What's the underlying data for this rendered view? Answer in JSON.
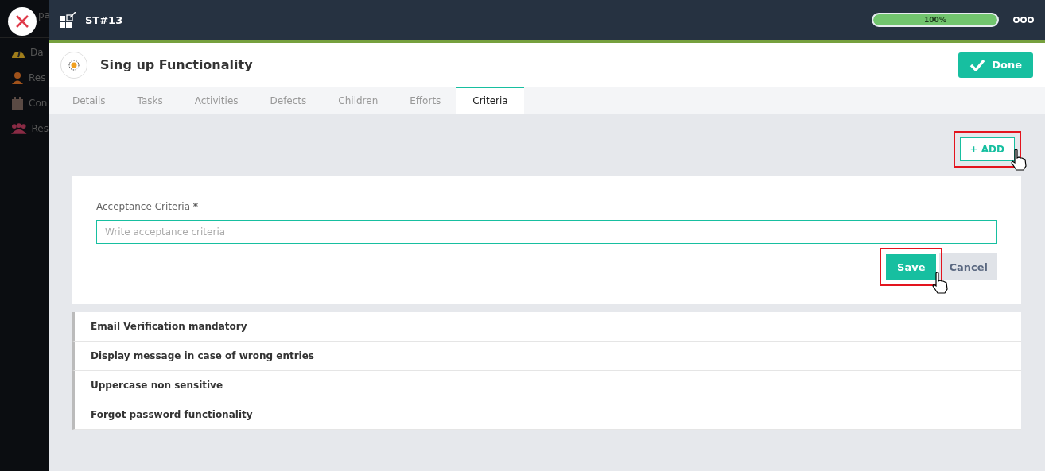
{
  "sidebar": {
    "header": "pa",
    "items": [
      {
        "label": "Da",
        "kind": "gauge"
      },
      {
        "label": "Res",
        "kind": "person"
      },
      {
        "label": "Con",
        "kind": "calendar"
      },
      {
        "label": "Res",
        "kind": "group"
      }
    ]
  },
  "topbar": {
    "id": "ST#13",
    "progress": {
      "level": 1,
      "reading": "100%"
    }
  },
  "header": {
    "title": "Sing up Functionality",
    "done_label": "Done"
  },
  "tabs": [
    {
      "label": "Details",
      "selected": false
    },
    {
      "label": "Tasks",
      "selected": false
    },
    {
      "label": "Activities",
      "selected": false
    },
    {
      "label": "Defects",
      "selected": false
    },
    {
      "label": "Children",
      "selected": false
    },
    {
      "label": "Efforts",
      "selected": false
    },
    {
      "label": "Criteria",
      "selected": true
    }
  ],
  "add_button": {
    "label": "+ ADD",
    "highlighted": true
  },
  "form": {
    "label": "Acceptance Criteria",
    "required_mark": "*",
    "placeholder": "Write acceptance criteria",
    "save": {
      "label": "Save",
      "highlighted": true
    },
    "cancel": {
      "label": "Cancel"
    }
  },
  "criteria": [
    {
      "text": "Email Verification mandatory"
    },
    {
      "text": "Display message in case of wrong entries"
    },
    {
      "text": "Uppercase non sensitive"
    },
    {
      "text": "Forgot password functionality"
    }
  ]
}
